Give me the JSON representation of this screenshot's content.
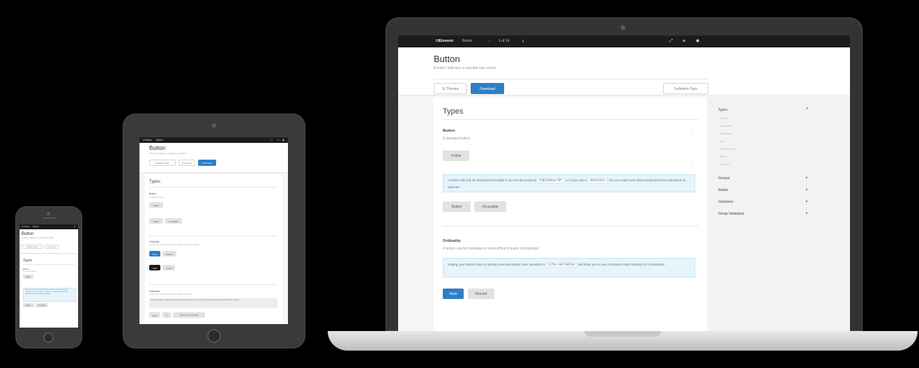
{
  "laptop": {
    "topbar": {
      "brand": "UIElement:",
      "page_name": "Button",
      "prev": "‹",
      "counter": "1 of 14",
      "next": "›",
      "icons": [
        "fullscreen-icon",
        "menu-icon",
        "settings-icon"
      ]
    },
    "header": {
      "title": "Button",
      "subtitle": "A button indicates a possible user action",
      "themes_btn": "11 Themes",
      "download_btn": "Download",
      "definition_btn": "Definition Type"
    },
    "main": {
      "section_title": "Types",
      "button_title": "Button",
      "button_desc": "A standard button",
      "follow_btn": "Follow",
      "focus_text_1": "A button will only be keyboard focusable if you set the property",
      "focus_code_1": "tabindex=\"0\"",
      "focus_text_2": ", or if you use a",
      "focus_code_2": "<button>",
      "focus_text_3": ". You can read more about keyboard focus standards at webAIM.",
      "button_btn": "Button",
      "focusable_btn": "Focusable",
      "ordinality_title": "Ordinality",
      "ordinality_desc": "A button can be formatted to show different levels of emphasis",
      "brand_text_1": "Setting your brand colors to primary and secondary color variables in",
      "brand_code": "site.variables",
      "brand_text_2": "will allow you to use consistent color theming for UI elements",
      "save_btn": "Save",
      "discard_btn": "Discard"
    },
    "sidebar": {
      "types": "Types",
      "type_items": [
        "Button",
        "Ordinality",
        "Animated",
        "Icon",
        "Labeled Icon",
        "Basic",
        "Inverted"
      ],
      "groups": "Groups",
      "states": "States",
      "variations": "Variations",
      "group_variations": "Group Variations"
    }
  },
  "tablet": {
    "topbar_brand": "UI Menu",
    "topbar_page": "Button",
    "title": "Button",
    "subtitle": "A button indicates a possible user action",
    "definition_btn": "Definition Type",
    "themes_btn": "11 Themes",
    "download_btn": "Download",
    "section_title": "Types",
    "button_title": "Button",
    "button_desc": "A standard button",
    "follow_btn": "Follow",
    "button_btn": "Button",
    "focusable_btn": "Focusable",
    "ordinality_title": "Ordinality",
    "ordinality_desc": "A button can be formatted to show different levels of emphasis",
    "save_btn": "Save",
    "discard_btn": "Discard",
    "okay_btn": "Okay",
    "cancel_btn": "Cancel",
    "emphasis_title": "Emphasis",
    "emphasis_desc": "A button can be formatted to show different emphasis",
    "emphasis_note": "The button will be rendered with emphasis depending on the context in which it is placed and the visibility of the element",
    "back_btn": "Back",
    "x_btn": "✕",
    "approve_btn": "Approve to all the fields"
  },
  "phone": {
    "topbar_brand": "UI Menu",
    "topbar_page": "Button",
    "title": "Button",
    "subtitle": "A button indicates a possible user action",
    "definition_btn": "Definition Type",
    "themes_btn": "11 Themes",
    "section_title": "Types",
    "button_title": "Button",
    "button_desc": "A standard button",
    "follow_btn": "Follow",
    "note": "A button will only be keyboard focusable if you set the property tabindex=\"0\", or if you use a <button>. You can read more about keyboard focus standards at webAIM.",
    "button_btn": "Button",
    "focusable_btn": "Focusable"
  }
}
